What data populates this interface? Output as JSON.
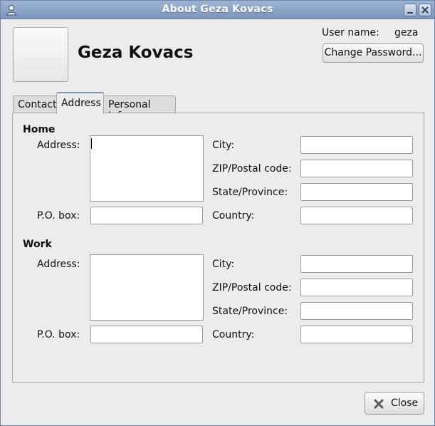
{
  "window": {
    "title": "About Geza Kovacs"
  },
  "header": {
    "full_name": "Geza Kovacs",
    "username_label": "User name:",
    "username_value": "geza",
    "change_password_label": "Change Password..."
  },
  "tabs": [
    {
      "label": "Contact",
      "selected": false
    },
    {
      "label": "Address",
      "selected": true
    },
    {
      "label": "Personal Info",
      "selected": false
    }
  ],
  "home": {
    "heading": "Home",
    "address_label": "Address:",
    "pobox_label": "P.O. box:",
    "city_label": "City:",
    "zip_label": "ZIP/Postal code:",
    "state_label": "State/Province:",
    "country_label": "Country:",
    "address_value": "",
    "pobox_value": "",
    "city_value": "",
    "zip_value": "",
    "state_value": "",
    "country_value": ""
  },
  "work": {
    "heading": "Work",
    "address_label": "Address:",
    "pobox_label": "P.O. box:",
    "city_label": "City:",
    "zip_label": "ZIP/Postal code:",
    "state_label": "State/Province:",
    "country_label": "Country:",
    "address_value": "",
    "pobox_value": "",
    "city_value": "",
    "zip_value": "",
    "state_value": "",
    "country_value": ""
  },
  "footer": {
    "close_label": "Close"
  },
  "icons": {
    "app": "user-icon",
    "close": "close-x-icon",
    "minimize": "minimize-icon"
  },
  "colors": {
    "titlebar": "#8aa3c8",
    "accent": "#7b95bd",
    "window_bg": "#ececec"
  }
}
